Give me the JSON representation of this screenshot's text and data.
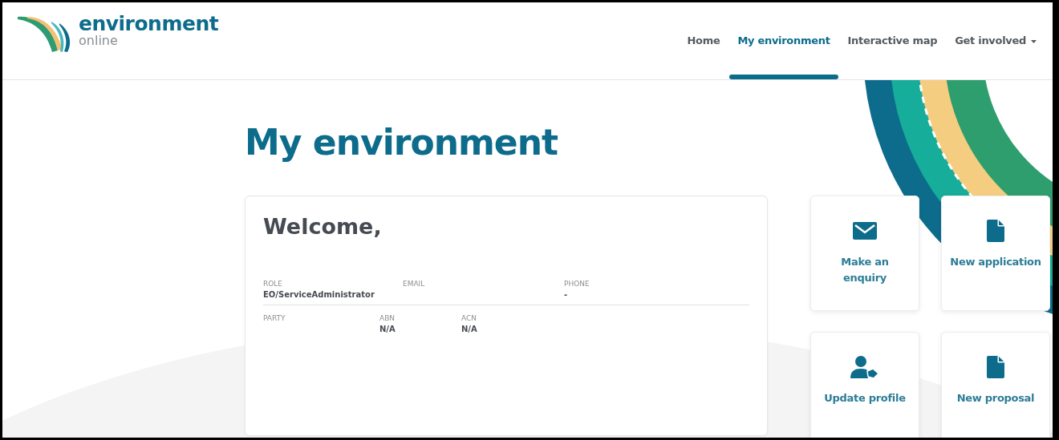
{
  "brand": {
    "name": "environment",
    "tagline": "online"
  },
  "nav": [
    {
      "label": "Home",
      "selected": false,
      "dropdown": false
    },
    {
      "label": "My environment",
      "selected": true,
      "dropdown": false
    },
    {
      "label": "Interactive map",
      "selected": false,
      "dropdown": false
    },
    {
      "label": "Get involved",
      "selected": false,
      "dropdown": true
    }
  ],
  "page_title": "My environment",
  "welcome_card": {
    "heading": "Welcome,",
    "rows": [
      [
        {
          "label": "ROLE",
          "value": "EO/ServiceAdministrator"
        },
        {
          "label": "EMAIL"
        },
        {
          "label": "PHONE",
          "value": "-"
        }
      ],
      [
        {
          "label": "PARTY"
        },
        {
          "label": "ABN",
          "value": "N/A"
        },
        {
          "label": "ACN",
          "value": "N/A"
        }
      ]
    ]
  },
  "tiles": [
    {
      "label": "Make an enquiry",
      "kind": "envelope"
    },
    {
      "label": "New application",
      "kind": "document"
    },
    {
      "label": "Update profile",
      "kind": "user-tag"
    },
    {
      "label": "New proposal",
      "kind": "document"
    }
  ]
}
